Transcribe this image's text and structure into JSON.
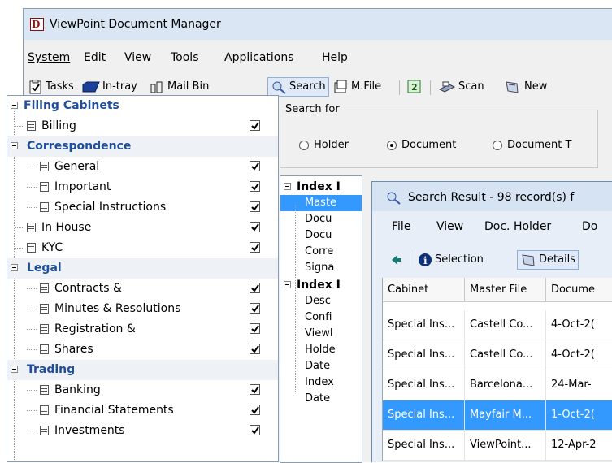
{
  "app": {
    "title": "ViewPoint Document Manager",
    "icon_letter": "D"
  },
  "menu": [
    "System",
    "Edit",
    "View",
    "Tools",
    "Applications",
    "Help"
  ],
  "toolbar": {
    "tasks": "Tasks",
    "intray": "In-tray",
    "mailbin": "Mail Bin",
    "search": "Search",
    "mfile": "M.File",
    "scan": "Scan",
    "new": "New"
  },
  "tree": {
    "root": "Filing Cabinets",
    "items": [
      {
        "label": "Billing",
        "type": "item",
        "checked": true
      },
      {
        "label": "Correspondence",
        "type": "group"
      },
      {
        "label": "General",
        "type": "sub",
        "checked": true
      },
      {
        "label": "Important",
        "type": "sub",
        "checked": true
      },
      {
        "label": "Special Instructions",
        "type": "sub",
        "checked": true
      },
      {
        "label": "In House",
        "type": "item",
        "checked": true
      },
      {
        "label": "KYC",
        "type": "item",
        "checked": true
      },
      {
        "label": "Legal",
        "type": "group"
      },
      {
        "label": "Contracts &",
        "type": "sub",
        "checked": true
      },
      {
        "label": "Minutes & Resolutions",
        "type": "sub",
        "checked": true
      },
      {
        "label": "Registration &",
        "type": "sub",
        "checked": true
      },
      {
        "label": "Shares",
        "type": "sub",
        "checked": true
      },
      {
        "label": "Trading",
        "type": "group"
      },
      {
        "label": "Banking",
        "type": "sub",
        "checked": true
      },
      {
        "label": "Financial Statements",
        "type": "sub",
        "checked": true
      },
      {
        "label": "Investments",
        "type": "sub",
        "checked": true
      }
    ]
  },
  "search_for": {
    "label": "Search for",
    "options": [
      "Holder",
      "Document",
      "Document T"
    ],
    "selected": "Document"
  },
  "index_panel": {
    "header1": "Index I",
    "items1": [
      "Maste",
      "Docu",
      "Docu",
      "Corre",
      "Signa"
    ],
    "header2": "Index I",
    "items2": [
      "Desc",
      "Confi",
      "Viewl",
      "Holde",
      "Date",
      "Index",
      "Date"
    ]
  },
  "results": {
    "title": "Search Result - 98 record(s) f",
    "menu": [
      "File",
      "View",
      "Doc. Holder",
      "Do"
    ],
    "toolbar": {
      "selection": "Selection",
      "details": "Details"
    },
    "columns": [
      "Cabinet",
      "Master File",
      "Docume"
    ],
    "rows": [
      [
        "Special Ins...",
        "Castell Co...",
        "4-Oct-2("
      ],
      [
        "Special Ins...",
        "Castell Co...",
        "4-Oct-2("
      ],
      [
        "Special Ins...",
        "Barcelona...",
        "24-Mar-"
      ],
      [
        "Special Ins...",
        "Mayfair M...",
        "1-Oct-2("
      ],
      [
        "Special Ins...",
        "ViewPoint...",
        "12-Apr-2"
      ]
    ],
    "selected_row": 3
  },
  "colors": {
    "accent": "#1f4e9c",
    "selection": "#3399ff"
  }
}
